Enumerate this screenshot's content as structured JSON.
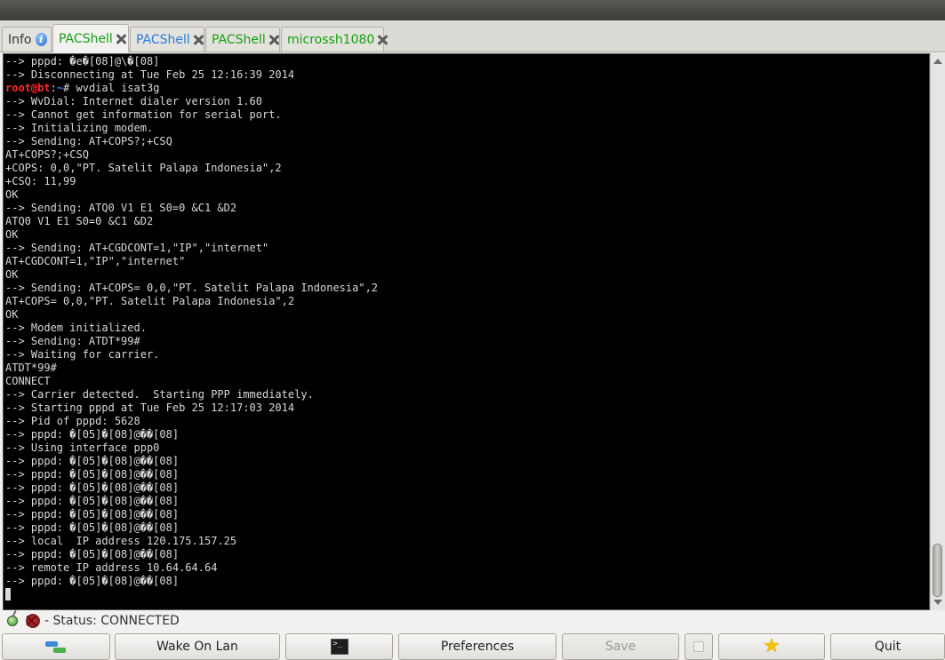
{
  "tabs": [
    {
      "label": "Info",
      "color": "#333333",
      "icon": "info-icon",
      "closable": false
    },
    {
      "label": "PACShell",
      "color": "#14a014",
      "active": true,
      "closable": true
    },
    {
      "label": "PACShell",
      "color": "#2a7ad6",
      "closable": true
    },
    {
      "label": "PACShell",
      "color": "#14a014",
      "closable": true
    },
    {
      "label": "microssh1080",
      "color": "#14a014",
      "closable": true
    }
  ],
  "terminal": {
    "lines": [
      "--> pppd: �e�[08]@\\�[08]",
      "--> Disconnecting at Tue Feb 25 12:16:39 2014",
      "",
      "--> WvDial: Internet dialer version 1.60",
      "--> Cannot get information for serial port.",
      "--> Initializing modem.",
      "--> Sending: AT+COPS?;+CSQ",
      "AT+COPS?;+CSQ",
      "+COPS: 0,0,\"PT. Satelit Palapa Indonesia\",2",
      "+CSQ: 11,99",
      "OK",
      "--> Sending: ATQ0 V1 E1 S0=0 &C1 &D2",
      "ATQ0 V1 E1 S0=0 &C1 &D2",
      "OK",
      "--> Sending: AT+CGDCONT=1,\"IP\",\"internet\"",
      "AT+CGDCONT=1,\"IP\",\"internet\"",
      "OK",
      "--> Sending: AT+COPS= 0,0,\"PT. Satelit Palapa Indonesia\",2",
      "AT+COPS= 0,0,\"PT. Satelit Palapa Indonesia\",2",
      "OK",
      "--> Modem initialized.",
      "--> Sending: ATDT*99#",
      "--> Waiting for carrier.",
      "ATDT*99#",
      "CONNECT",
      "--> Carrier detected.  Starting PPP immediately.",
      "--> Starting pppd at Tue Feb 25 12:17:03 2014",
      "--> Pid of pppd: 5628",
      "--> pppd: �[05]�[08]@��[08]",
      "--> Using interface ppp0",
      "--> pppd: �[05]�[08]@��[08]",
      "--> pppd: �[05]�[08]@��[08]",
      "--> pppd: �[05]�[08]@��[08]",
      "--> pppd: �[05]�[08]@��[08]",
      "--> pppd: �[05]�[08]@��[08]",
      "--> pppd: �[05]�[08]@��[08]",
      "--> local  IP address 120.175.157.25",
      "--> pppd: �[05]�[08]@��[08]",
      "--> remote IP address 10.64.64.64",
      "--> pppd: �[05]�[08]@��[08]"
    ],
    "prompt": {
      "user": "root@bt",
      "sep": ":",
      "path": "~",
      "symbol": "# ",
      "command": "wvdial isat3g",
      "line_index": 2
    },
    "colors": {
      "background": "#000000",
      "text": "#d8d8d8",
      "user": "#ff2b2b",
      "path": "#4c73ff"
    }
  },
  "status": {
    "text": "- Status: CONNECTED",
    "icons": [
      "connection-icon",
      "network-disconnect-icon"
    ]
  },
  "buttons": {
    "network_icon": "network-settings-icon",
    "wake_on_lan": "Wake On Lan",
    "terminal_icon": "terminal-icon",
    "preferences": "Preferences",
    "save": "Save",
    "favourite_icon": "star-icon",
    "quit": "Quit"
  }
}
